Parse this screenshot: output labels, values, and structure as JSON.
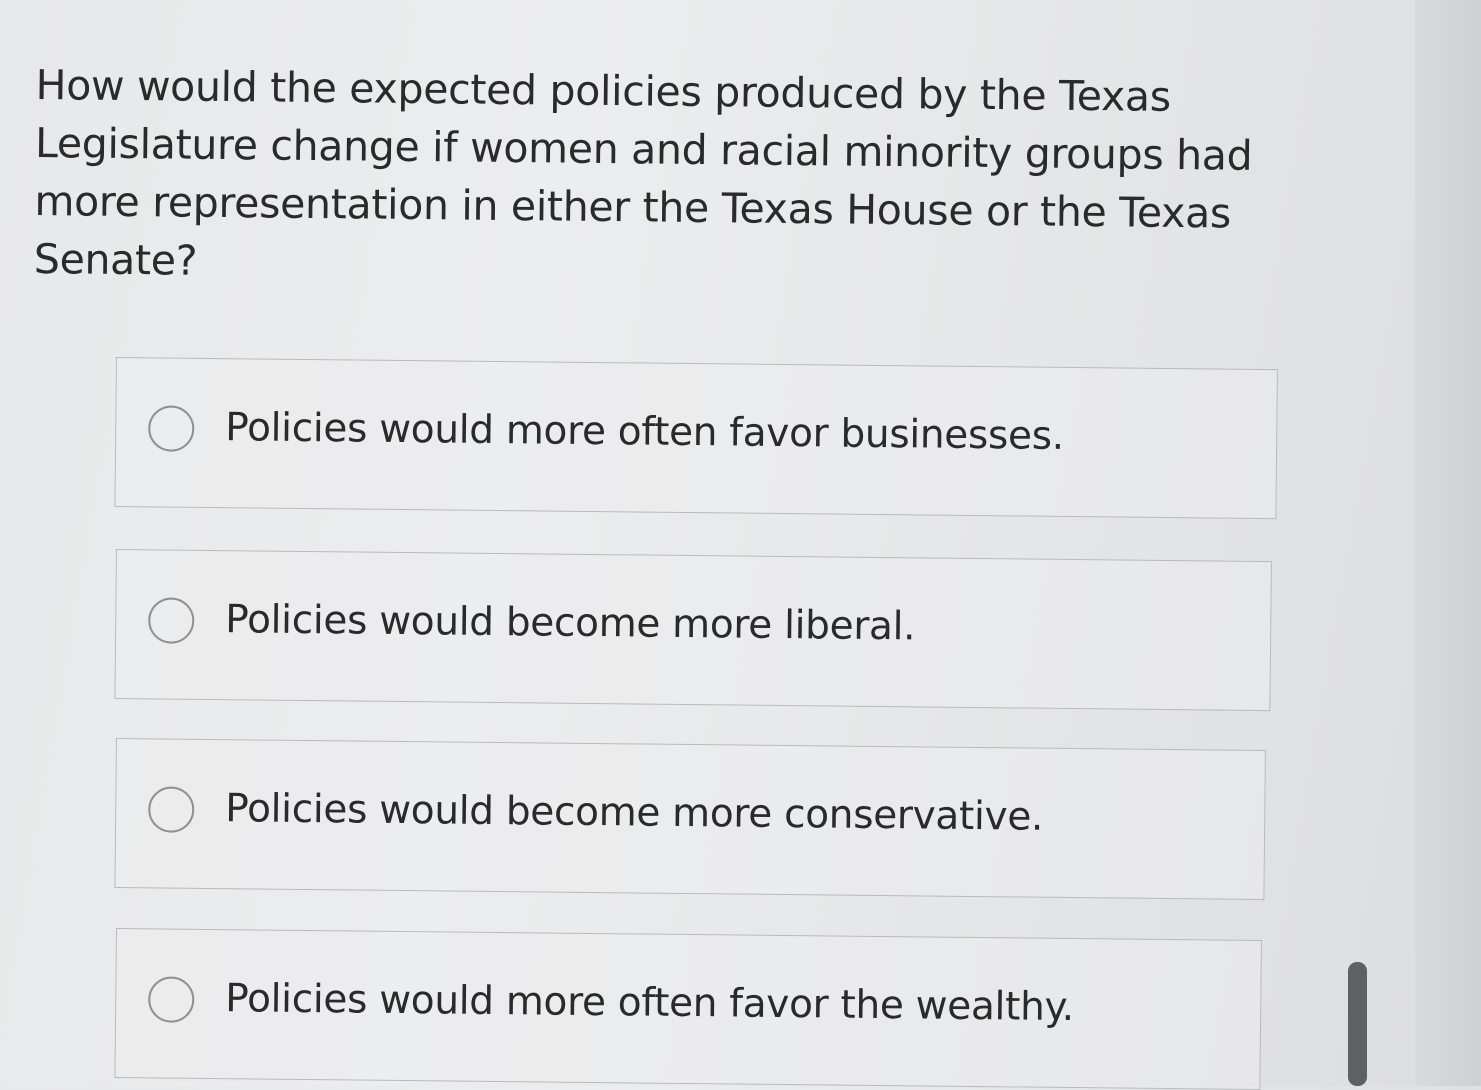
{
  "question": {
    "text": "How would the expected policies produced by the Texas Legislature change if women and racial minority groups had more representation in either the Texas House or the Texas Senate?"
  },
  "options": [
    {
      "label": "Policies would more often favor businesses.",
      "selected": false
    },
    {
      "label": "Policies would become more liberal.",
      "selected": false
    },
    {
      "label": "Policies would become more conservative.",
      "selected": false
    },
    {
      "label": "Policies would more often favor the wealthy.",
      "selected": false
    }
  ],
  "colors": {
    "background": "#e8e9ea",
    "text": "#2a2a2a",
    "border": "#b9babc",
    "radio_border": "#8f9092",
    "scrollbar": "#5f6062"
  },
  "icons": {
    "option_marker": "radio-button-unselected-icon"
  }
}
